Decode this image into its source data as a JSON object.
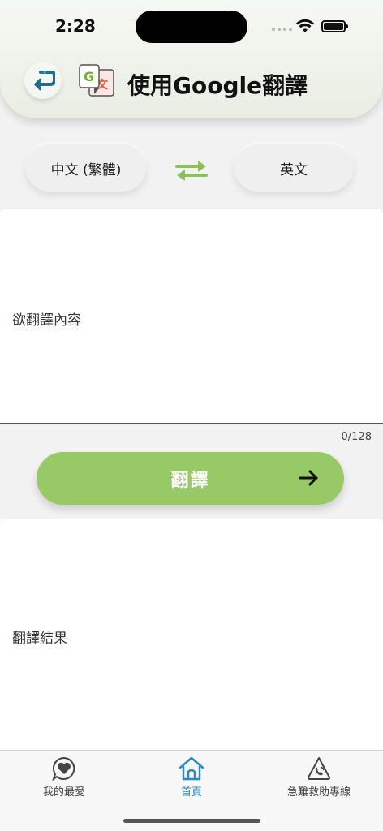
{
  "status_bar": {
    "time": "2:28"
  },
  "header": {
    "title": "使用Google翻譯",
    "back_icon": "back-arrow-icon",
    "app_icon": "google-translate-icon"
  },
  "languages": {
    "source": "中文 (繁體)",
    "target": "英文",
    "swap_icon": "swap-arrows-icon"
  },
  "input": {
    "placeholder": "欲翻譯內容",
    "counter": "0/128"
  },
  "translate_button": {
    "label": "翻譯",
    "icon": "arrow-right-icon"
  },
  "result": {
    "placeholder": "翻譯結果"
  },
  "tabs": [
    {
      "label": "我的最愛",
      "icon": "heart-chat-icon"
    },
    {
      "label": "首頁",
      "icon": "home-icon",
      "active": true
    },
    {
      "label": "急難救助專線",
      "icon": "phone-icon"
    }
  ],
  "colors": {
    "accent_green": "#97c967",
    "active_tab": "#2a8bbf",
    "back_blue": "#1f6d93"
  }
}
